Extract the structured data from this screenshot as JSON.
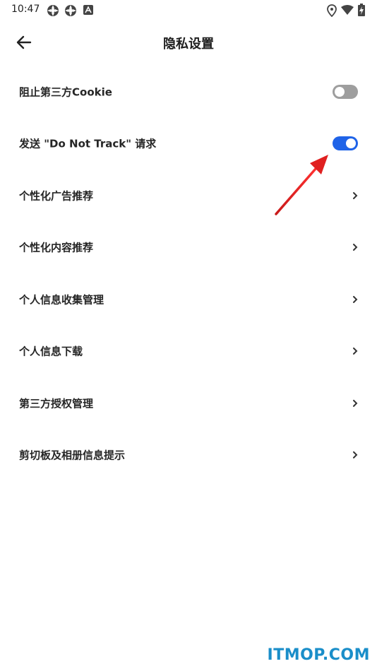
{
  "status_bar": {
    "time": "10:47"
  },
  "app_bar": {
    "title": "隐私设置"
  },
  "settings": {
    "block_third_party_cookie": {
      "label": "阻止第三方Cookie",
      "enabled": false
    },
    "do_not_track": {
      "label": "发送 \"Do Not Track\" 请求",
      "enabled": true
    },
    "items": [
      {
        "label": "个性化广告推荐"
      },
      {
        "label": "个性化内容推荐"
      },
      {
        "label": "个人信息收集管理"
      },
      {
        "label": "个人信息下载"
      },
      {
        "label": "第三方授权管理"
      },
      {
        "label": "剪切板及相册信息提示"
      }
    ]
  },
  "colors": {
    "toggle_on": "#1f63e8",
    "toggle_off": "#9e9e9e",
    "arrow": "#e02020",
    "watermark": "#1a8ec9"
  },
  "watermark": "ITMOP.COM"
}
